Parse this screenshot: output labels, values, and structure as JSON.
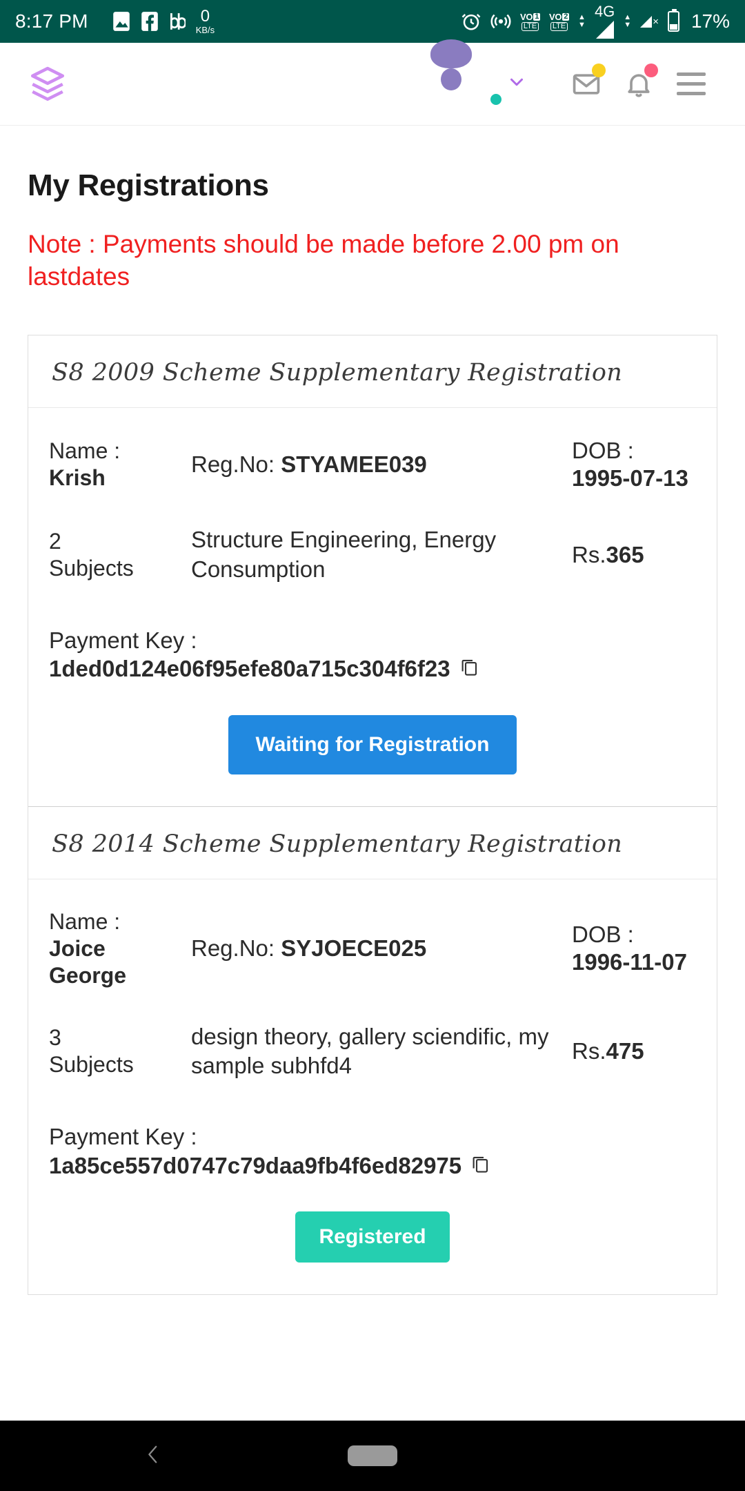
{
  "status_bar": {
    "time": "8:17 PM",
    "network_speed_value": "0",
    "network_speed_unit": "KB/s",
    "left_icons": [
      "gallery-icon",
      "facebook-icon",
      "bb-icon"
    ],
    "right_icons": [
      "alarm-icon",
      "hotspot-icon",
      "volte-sim1-icon",
      "volte-sim2-icon",
      "signal-4g-icon",
      "signal-sim2-icon",
      "battery-icon"
    ],
    "volte_sim1": "VO",
    "volte_sim1_num": "1",
    "volte_sim1_lte": "LTE",
    "volte_sim2": "VO",
    "volte_sim2_num": "2",
    "volte_sim2_lte": "LTE",
    "network_type": "4G",
    "battery_percent": "17%",
    "background_color": "#00564b"
  },
  "app_bar": {
    "logo_icon": "layers-stack-icon",
    "logo_color": "#cf8ef2",
    "avatar_icon": "user-avatar-icon",
    "online_indicator_color": "#18c2ad",
    "dropdown_icon": "chevron-down-icon",
    "mail_icon": "mail-icon",
    "mail_badge_color": "#f9d020",
    "bell_icon": "bell-icon",
    "bell_badge_color": "#fc5d7d",
    "menu_icon": "hamburger-menu-icon"
  },
  "page": {
    "title": "My Registrations",
    "note": "Note : Payments should be made before 2.00 pm on lastdates",
    "note_color": "#f02020"
  },
  "labels": {
    "name": "Name :",
    "reg_no": "Reg.No:",
    "dob": "DOB :",
    "subjects": "Subjects",
    "payment_key": "Payment Key :",
    "currency": "Rs.",
    "copy_icon": "copy-icon"
  },
  "registrations": [
    {
      "scheme_title": "S8 2009 Scheme Supplementary Registration",
      "name": "Krish",
      "reg_no": "STYAMEE039",
      "dob": "1995-07-13",
      "subject_count": "2",
      "subjects": "Structure Engineering, Energy Consumption",
      "fee": "365",
      "payment_key": "1ded0d124e06f95efe80a715c304f6f23",
      "status_label": "Waiting for Registration",
      "status_color": "#2189e0"
    },
    {
      "scheme_title": "S8 2014 Scheme Supplementary Registration",
      "name": "Joice George",
      "reg_no": "SYJOECE025",
      "dob": "1996-11-07",
      "subject_count": "3",
      "subjects": "design theory, gallery sciendific, my sample subhfd4",
      "fee": "475",
      "payment_key": "1a85ce557d0747c79daa9fb4f6ed82975",
      "status_label": "Registered",
      "status_color": "#25cfb0"
    }
  ],
  "nav_bar": {
    "back_icon": "back-chevron-icon",
    "home_icon": "home-pill-icon"
  }
}
